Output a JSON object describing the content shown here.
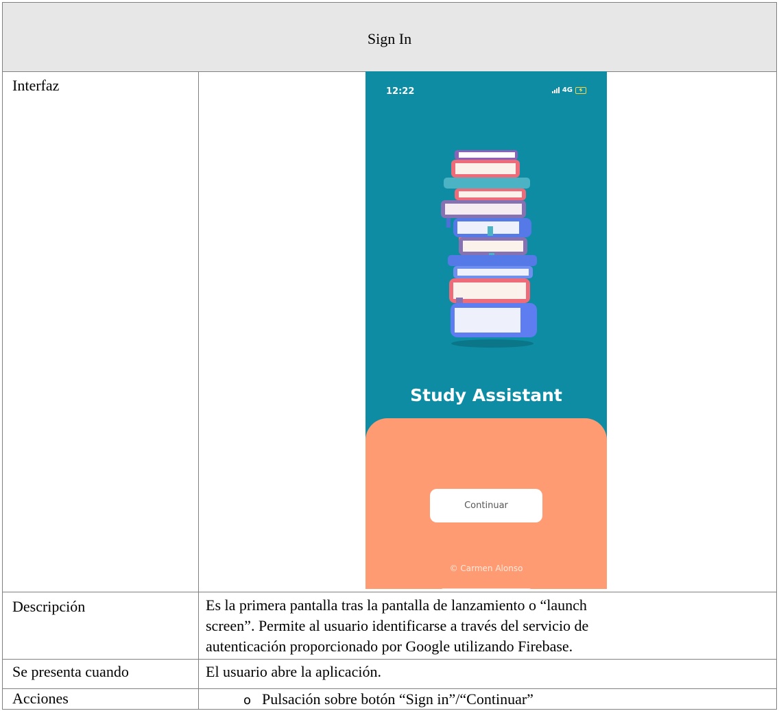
{
  "header": {
    "title": "Sign In"
  },
  "rows": {
    "interfaz": {
      "label": "Interfaz"
    },
    "descripcion": {
      "label": "Descripción",
      "lines": [
        "Es la primera pantalla tras la pantalla de lanzamiento o “launch",
        "screen”. Permite al usuario identificarse a través del servicio de",
        "autenticación proporcionado por Google utilizando Firebase."
      ]
    },
    "cuando": {
      "label": "Se presenta cuando",
      "text": "El usuario abre la aplicación."
    },
    "acciones": {
      "label": "Acciones",
      "bullet": "o",
      "text": "Pulsación sobre botón “Sign in”/“Continuar”"
    }
  },
  "phone": {
    "time": "12:22",
    "network": "4G",
    "app_title": "Study Assistant",
    "continue_label": "Continuar",
    "copyright": "© Carmen Alonso",
    "colors": {
      "background": "#0d8ca3",
      "panel": "#ff9b72"
    }
  }
}
